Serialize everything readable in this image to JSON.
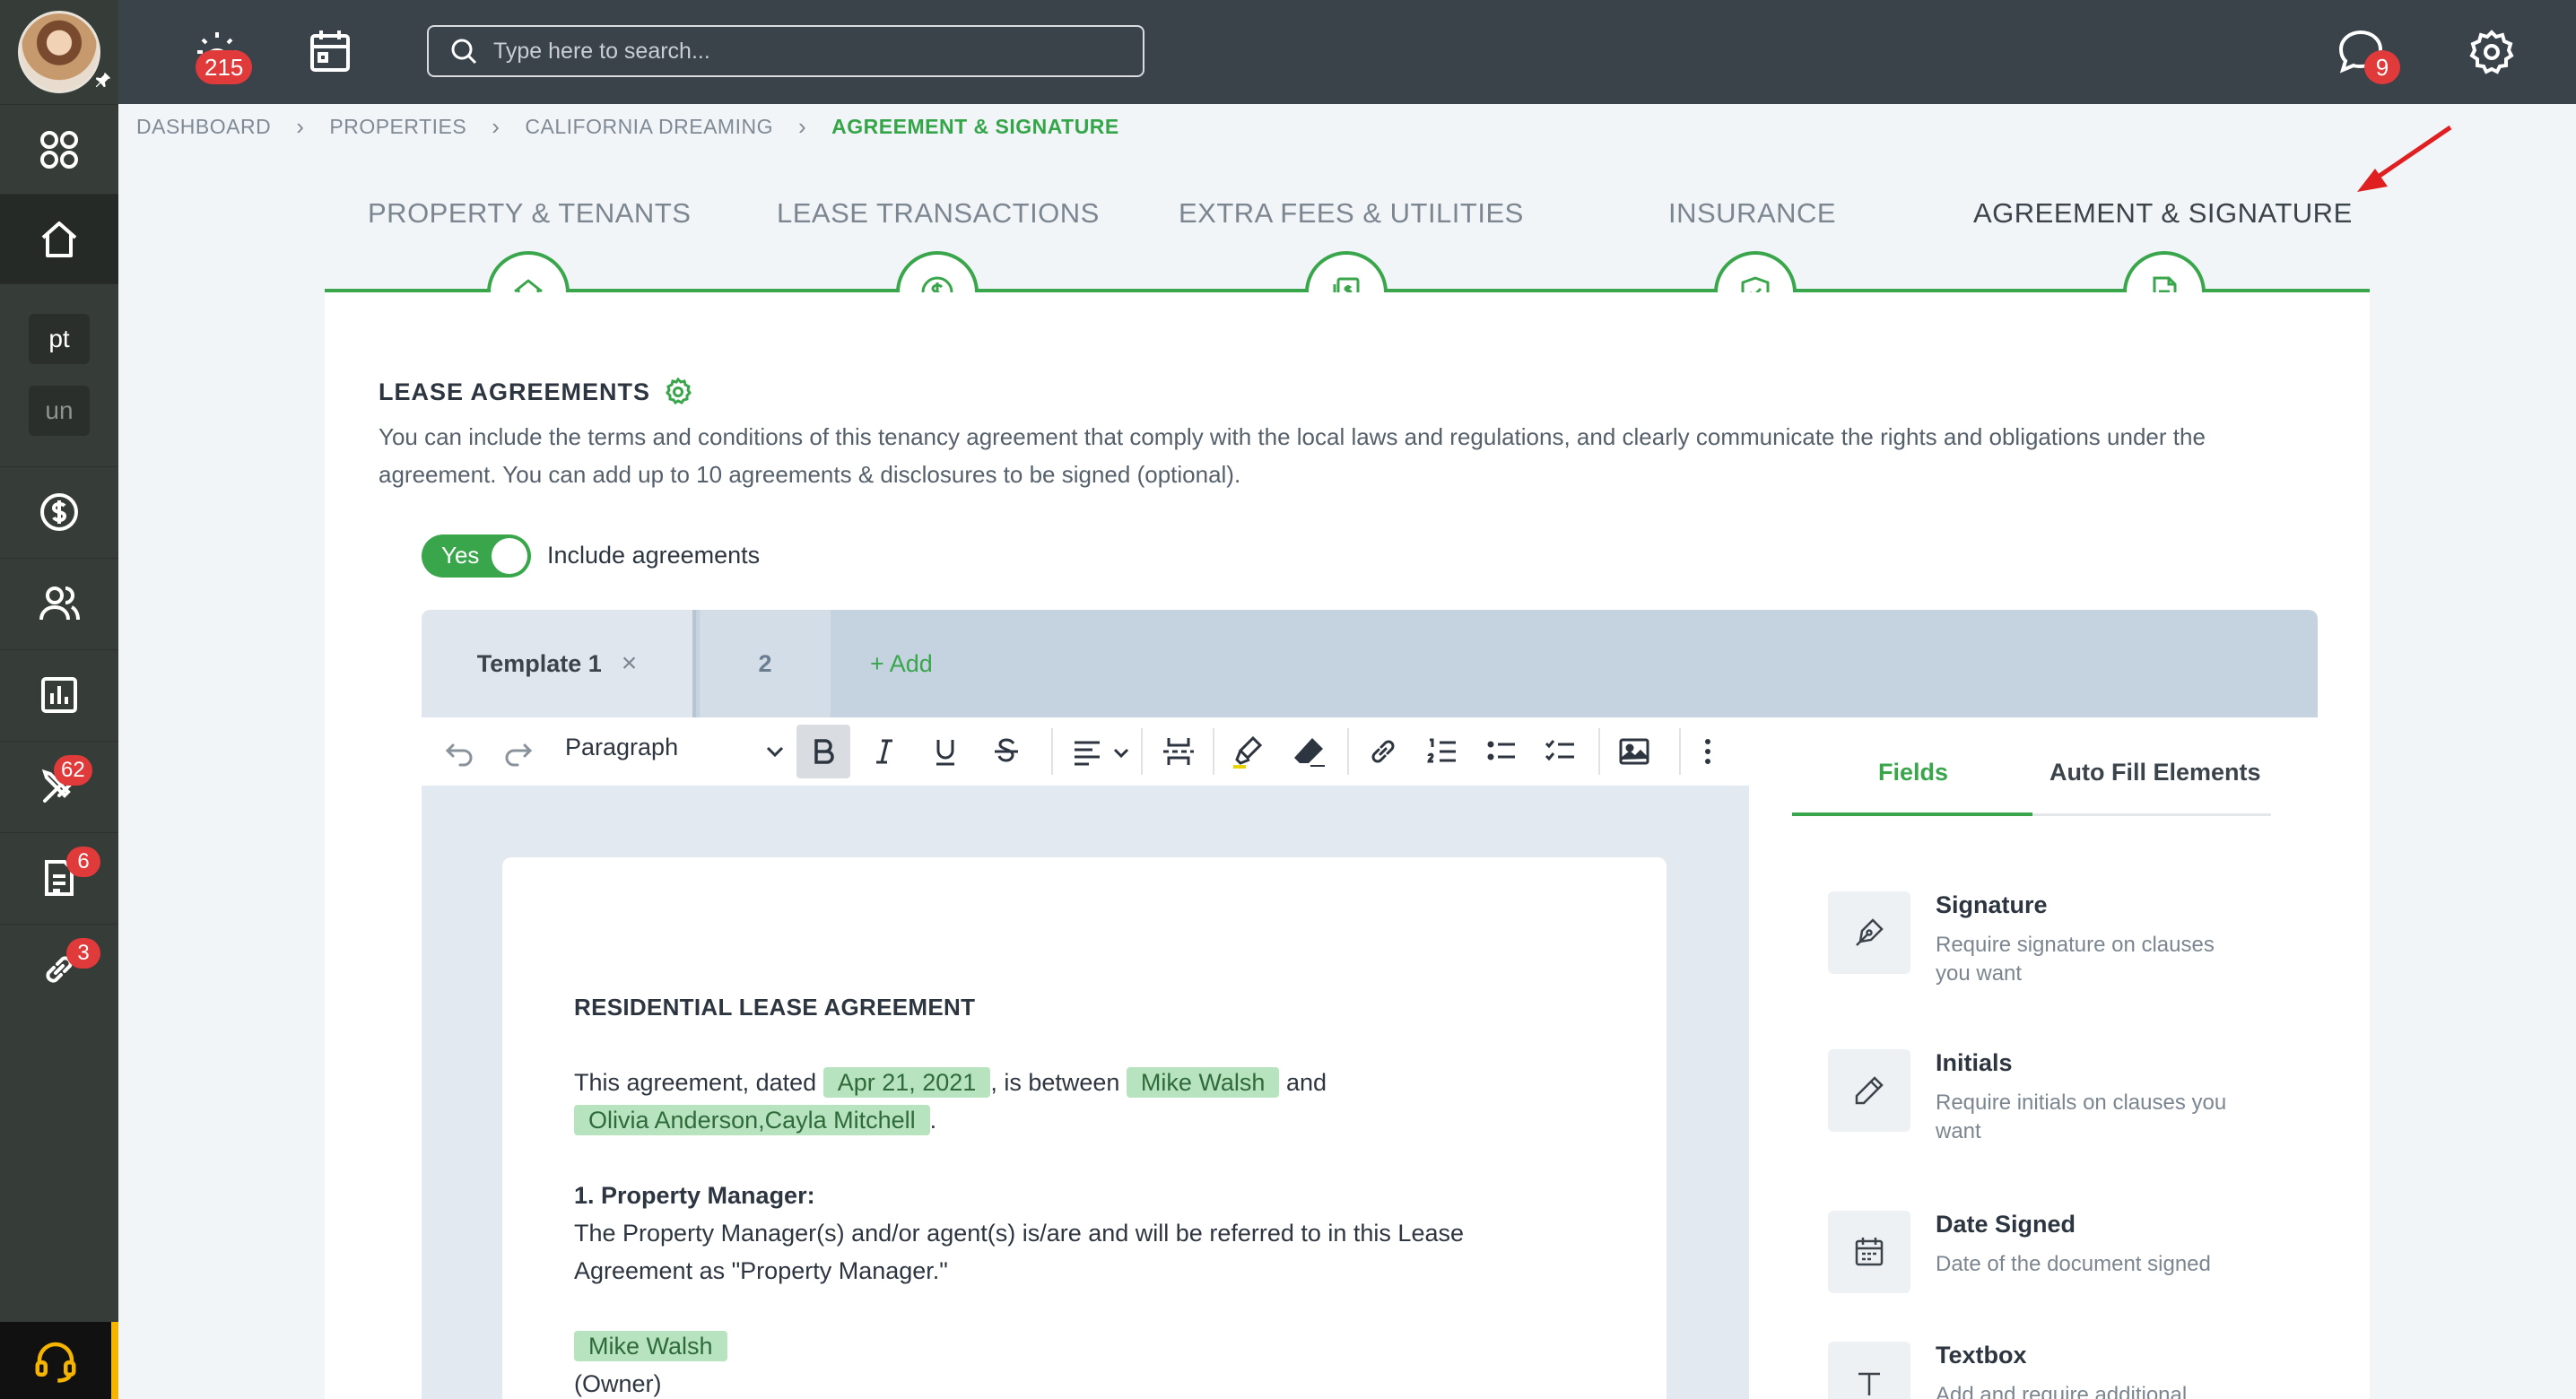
{
  "topbar": {
    "notifications_count": "215",
    "search_placeholder": "Type here to search...",
    "messages_count": "9"
  },
  "sidebar": {
    "text_item_1": "pt",
    "text_item_2": "un",
    "maintenance_count": "62",
    "documents_count": "6",
    "links_count": "3"
  },
  "breadcrumb": [
    "DASHBOARD",
    "PROPERTIES",
    "CALIFORNIA DREAMING",
    "AGREEMENT & SIGNATURE"
  ],
  "steps": [
    {
      "label": "PROPERTY & TENANTS",
      "icon": "house-icon"
    },
    {
      "label": "LEASE TRANSACTIONS",
      "icon": "dollar-icon"
    },
    {
      "label": "EXTRA FEES & UTILITIES",
      "icon": "bills-icon"
    },
    {
      "label": "INSURANCE",
      "icon": "shield-icon"
    },
    {
      "label": "AGREEMENT & SIGNATURE",
      "icon": "document-icon"
    }
  ],
  "section": {
    "title": "LEASE AGREEMENTS",
    "description": "You can include the terms and conditions of this tenancy agreement that comply with the local laws and regulations, and clearly communicate the rights and obligations under the agreement. You can add up to 10 agreements & disclosures to be signed (optional).",
    "toggle_label": "Yes",
    "include_label": "Include agreements"
  },
  "tabs": {
    "template1": "Template 1",
    "close_symbol": "×",
    "template2": "2",
    "add": "+ Add"
  },
  "editor": {
    "paragraph_style": "Paragraph"
  },
  "document": {
    "heading": "RESIDENTIAL LEASE AGREEMENT",
    "p1_start": "This agreement, dated",
    "date": "Apr 21, 2021",
    "p1_mid": ", is between",
    "landlord": "Mike Walsh",
    "p1_and": "and",
    "tenants": "Olivia Anderson,Cayla Mitchell",
    "p1_end": ".",
    "s1_title": "1. Property Manager:",
    "s1_text": "The Property Manager(s) and/or agent(s) is/are and will be referred to in this Lease Agreement as \"Property Manager.\"",
    "manager": "Mike Walsh",
    "manager_role": "(Owner)"
  },
  "fields_panel": {
    "tab_fields": "Fields",
    "tab_autofill": "Auto Fill Elements",
    "items": [
      {
        "title": "Signature",
        "desc": "Require signature on clauses you want",
        "icon": "signature-pen-icon"
      },
      {
        "title": "Initials",
        "desc": "Require initials on clauses you want",
        "icon": "pencil-icon"
      },
      {
        "title": "Date Signed",
        "desc": "Date of the document signed",
        "icon": "calendar-icon"
      },
      {
        "title": "Textbox",
        "desc": "Add and require additional",
        "icon": "text-icon"
      }
    ]
  },
  "colors": {
    "accent": "#3aa64b",
    "topbar": "#3a424a",
    "sidebar": "#363c38",
    "badge": "#e13a3a",
    "annotation_arrow": "#e02020"
  }
}
